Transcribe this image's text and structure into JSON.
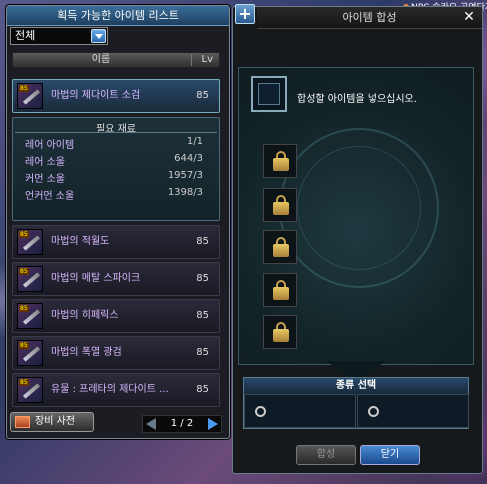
{
  "background": {
    "npc_text": "NPC 슬라오 공연다지"
  },
  "left_panel": {
    "title": "획득 가능한 아이템 리스트",
    "filter_value": "전체",
    "header": {
      "name": "이름",
      "lv": "Lv"
    },
    "items": [
      {
        "name": "마법의 제다이트 소검",
        "lv": "85"
      },
      {
        "name": "마법의 적월도",
        "lv": "85"
      },
      {
        "name": "마법의 메탈 스파이크",
        "lv": "85"
      },
      {
        "name": "마법의 히페릭스",
        "lv": "85"
      },
      {
        "name": "마법의 폭열 광검",
        "lv": "85"
      },
      {
        "name": "유물 : 프레타의 제다이트 ...",
        "lv": "85"
      }
    ],
    "materials": {
      "title": "필요 재료",
      "rows": [
        {
          "name": "레어 아이템",
          "qty": "1/1"
        },
        {
          "name": "레어 소울",
          "qty": "644/3"
        },
        {
          "name": "커먼 소울",
          "qty": "1957/3"
        },
        {
          "name": "언커먼 소울",
          "qty": "1398/3"
        }
      ]
    },
    "dict_button": "장비 사전",
    "pager": "1 / 2"
  },
  "right_panel": {
    "title": "아이템 합성",
    "hint": "합성할 아이템을 넣으십시오.",
    "type_title": "종류 선택",
    "combine_button": "합성",
    "close_button": "닫기"
  }
}
